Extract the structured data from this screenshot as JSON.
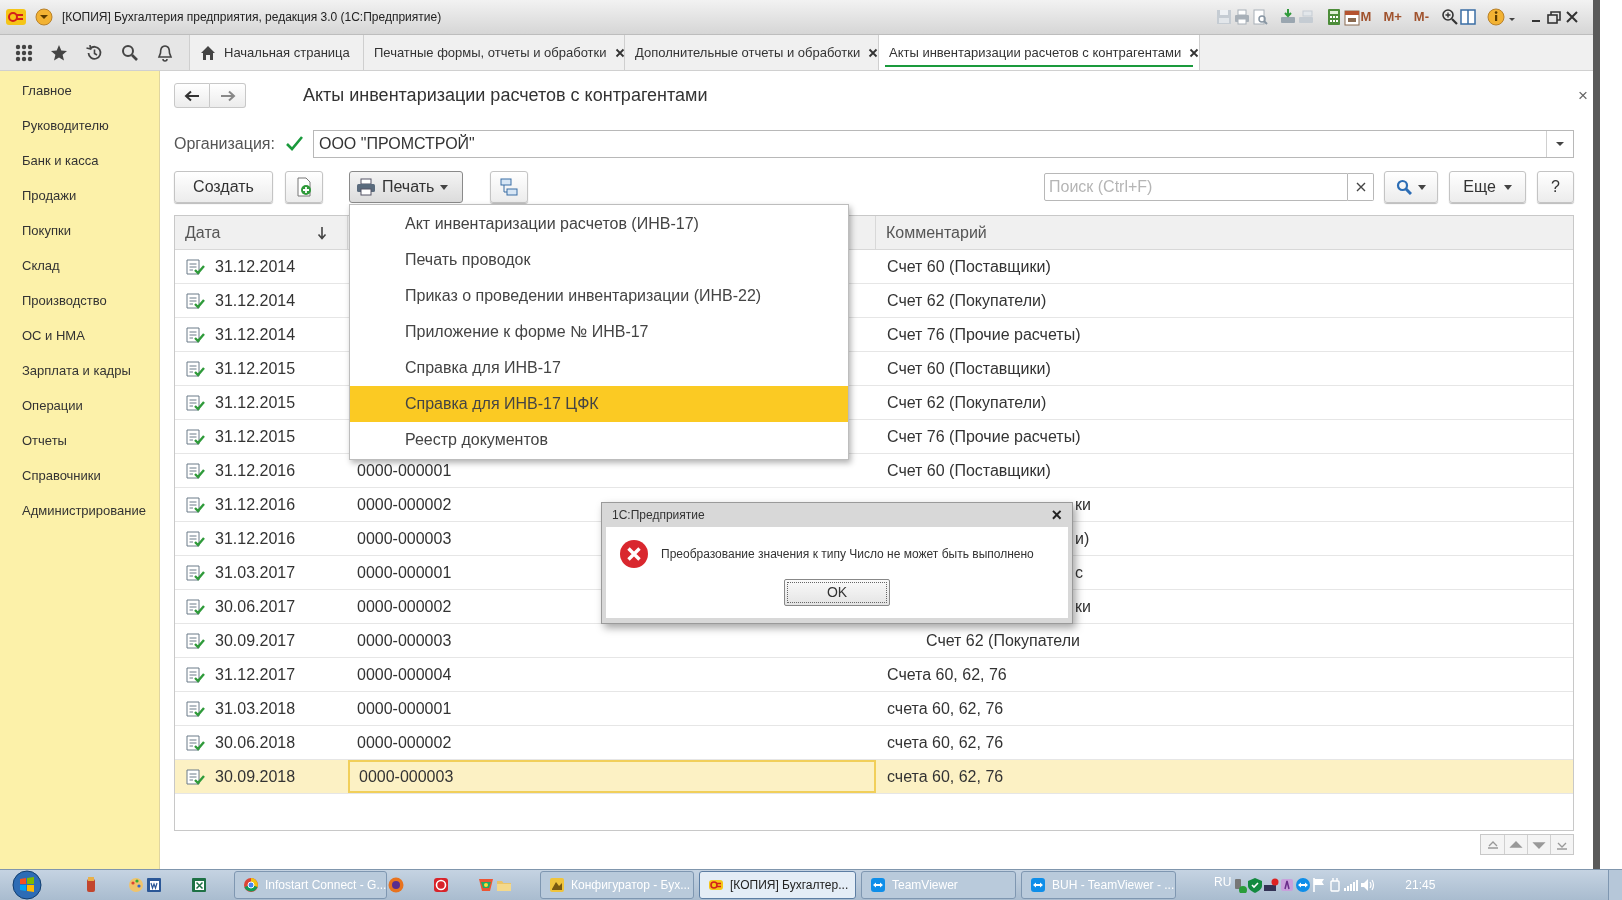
{
  "window": {
    "title": "[КОПИЯ] Бухгалтерия предприятия, редакция 3.0  (1С:Предприятие)",
    "memory_buttons": [
      "M",
      "M+",
      "M-"
    ]
  },
  "tabs": [
    {
      "label": "Начальная страница",
      "selected": false,
      "closable": false
    },
    {
      "label": "Печатные формы, отчеты и обработки",
      "selected": false,
      "closable": true
    },
    {
      "label": "Дополнительные отчеты и обработки",
      "selected": false,
      "closable": true
    },
    {
      "label": "Акты инвентаризации расчетов с контрагентами",
      "selected": true,
      "closable": true
    }
  ],
  "sidebar": {
    "items": [
      {
        "label": "Главное"
      },
      {
        "label": "Руководителю"
      },
      {
        "label": "Банк и касса"
      },
      {
        "label": "Продажи"
      },
      {
        "label": "Покупки"
      },
      {
        "label": "Склад"
      },
      {
        "label": "Производство"
      },
      {
        "label": "ОС и НМА"
      },
      {
        "label": "Зарплата и кадры"
      },
      {
        "label": "Операции"
      },
      {
        "label": "Отчеты"
      },
      {
        "label": "Справочники"
      },
      {
        "label": "Администрирование"
      }
    ]
  },
  "form": {
    "title": "Акты инвентаризации расчетов с контрагентами",
    "close": "×",
    "organization": {
      "label": "Организация:",
      "checked": true,
      "value": "ООО \"ПРОМСТРОЙ\""
    },
    "toolbar": {
      "create": "Создать",
      "print": "Печать",
      "search_placeholder": "Поиск (Ctrl+F)",
      "more": "Еще",
      "help": "?"
    }
  },
  "table": {
    "columns": [
      {
        "label": "Дата"
      },
      {
        "label": "Комментарий"
      }
    ],
    "rows": [
      {
        "date": "31.12.2014",
        "comment": "Счет 60 (Поставщики)",
        "selected": false
      },
      {
        "date": "31.12.2014",
        "comment": "Счет 62 (Покупатели)",
        "selected": false
      },
      {
        "date": "31.12.2014",
        "comment": "Счет 76 (Прочие расчеты)",
        "selected": false
      },
      {
        "date": "31.12.2015",
        "comment": "Счет 60 (Поставщики)",
        "selected": false
      },
      {
        "date": "31.12.2015",
        "comment": "Счет 62 (Покупатели)",
        "selected": false
      },
      {
        "date": "31.12.2015",
        "comment": "Счет 76 (Прочие расчеты)",
        "selected": false
      },
      {
        "date": "31.12.2016",
        "number": "0000-000001",
        "comment": "Счет 60 (Поставщики)",
        "selected": false
      },
      {
        "date": "31.12.2016",
        "number": "0000-000002",
        "comment": "ки",
        "partly_hidden": true,
        "selected": false
      },
      {
        "date": "31.12.2016",
        "number": "0000-000003",
        "comment": "и)",
        "partly_hidden": true,
        "selected": false
      },
      {
        "date": "31.03.2017",
        "number": "0000-000001",
        "comment": "с",
        "partly_hidden": true,
        "selected": false
      },
      {
        "date": "30.06.2017",
        "number": "0000-000002",
        "comment": "ки",
        "partly_hidden": true,
        "selected": false
      },
      {
        "date": "30.09.2017",
        "number": "0000-000003",
        "comment": "Счет 62 (Покупатели",
        "shifted": true,
        "selected": false
      },
      {
        "date": "31.12.2017",
        "number": "0000-000004",
        "comment": "Счета 60, 62, 76",
        "selected": false
      },
      {
        "date": "31.03.2018",
        "number": "0000-000001",
        "comment": "счета 60, 62, 76",
        "selected": false
      },
      {
        "date": "30.06.2018",
        "number": "0000-000002",
        "comment": "счета 60, 62, 76",
        "selected": false
      },
      {
        "date": "30.09.2018",
        "number": "0000-000003",
        "comment": "счета 60, 62, 76",
        "selected": true
      }
    ]
  },
  "print_menu": {
    "items": [
      {
        "label": "Акт инвентаризации расчетов (ИНВ-17)",
        "selected": false
      },
      {
        "label": "Печать проводок",
        "selected": false
      },
      {
        "label": "Приказ о проведении инвентаризации (ИНВ-22)",
        "selected": false
      },
      {
        "label": "Приложение к форме № ИНВ-17",
        "selected": false
      },
      {
        "label": "Справка для ИНВ-17",
        "selected": false
      },
      {
        "label": "Справка для ИНВ-17 ЦФК",
        "selected": true
      },
      {
        "label": "Реестр документов",
        "selected": false
      }
    ]
  },
  "dialog": {
    "title": "1С:Предприятие",
    "close": "×",
    "message": "Преобразование значения к типу Число не может быть выполнено",
    "button": "OK"
  },
  "taskbar": {
    "items": [
      {
        "kind": "icon"
      },
      {
        "kind": "icon"
      },
      {
        "kind": "icon"
      },
      {
        "kind": "icon"
      },
      {
        "kind": "task",
        "label": "Infostart Connect - G...",
        "active": false
      },
      {
        "kind": "icon"
      },
      {
        "kind": "icon"
      },
      {
        "kind": "icon"
      },
      {
        "kind": "icon"
      },
      {
        "kind": "task",
        "label": "Конфигуратор - Бух...",
        "active": false
      },
      {
        "kind": "task",
        "label": "[КОПИЯ] Бухгалтер...",
        "active": true
      },
      {
        "kind": "task",
        "label": "TeamViewer",
        "active": false
      },
      {
        "kind": "task",
        "label": "BUH - TeamViewer - ...",
        "active": false
      }
    ],
    "language": "RU",
    "clock": "21:45"
  }
}
